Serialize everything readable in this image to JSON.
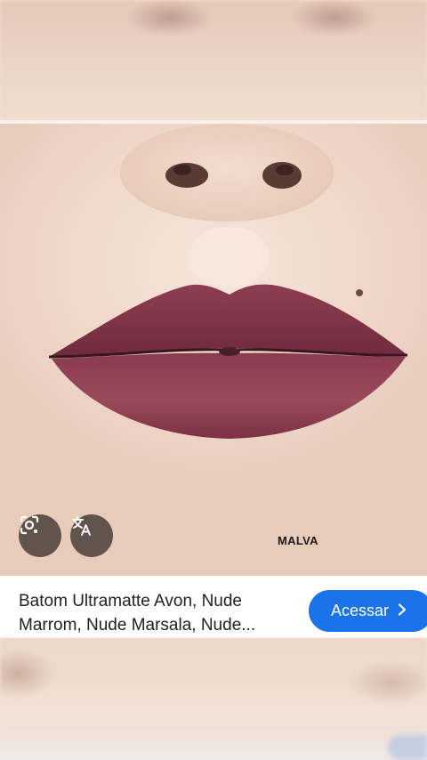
{
  "photo": {
    "caption": "MALVA"
  },
  "buttons": {
    "lens_icon": "google-lens-icon",
    "translate_icon": "translate-icon"
  },
  "result": {
    "title": "Batom Ultramatte Avon, Nude Marrom, Nude Marsala, Nude...",
    "visit_label": "Acessar",
    "visit_icon": "chevron-right-icon"
  },
  "colors": {
    "accent": "#1a73e8",
    "lip": "#8a3a4d",
    "skin": "#efd7c8"
  }
}
